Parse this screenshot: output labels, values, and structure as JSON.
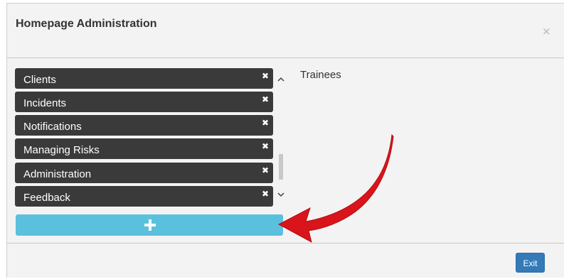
{
  "modal": {
    "title": "Homepage Administration",
    "close_glyph": "×"
  },
  "list": {
    "items": [
      {
        "label": "Clients",
        "remove_glyph": "✖"
      },
      {
        "label": "Incidents",
        "remove_glyph": "✖"
      },
      {
        "label": "Notifications",
        "remove_glyph": "✖"
      },
      {
        "label": "Managing Risks",
        "remove_glyph": "✖"
      },
      {
        "label": "Administration",
        "remove_glyph": "✖"
      },
      {
        "label": "Feedback",
        "remove_glyph": "✖"
      }
    ],
    "add_button_icon": "plus-icon"
  },
  "side_panel": {
    "label": "Trainees"
  },
  "footer": {
    "exit_label": "Exit"
  },
  "colors": {
    "item_bg": "#3a3a3a",
    "add_button": "#5bc0de",
    "exit_button": "#337ab7",
    "annotation_arrow": "#d9141b"
  }
}
